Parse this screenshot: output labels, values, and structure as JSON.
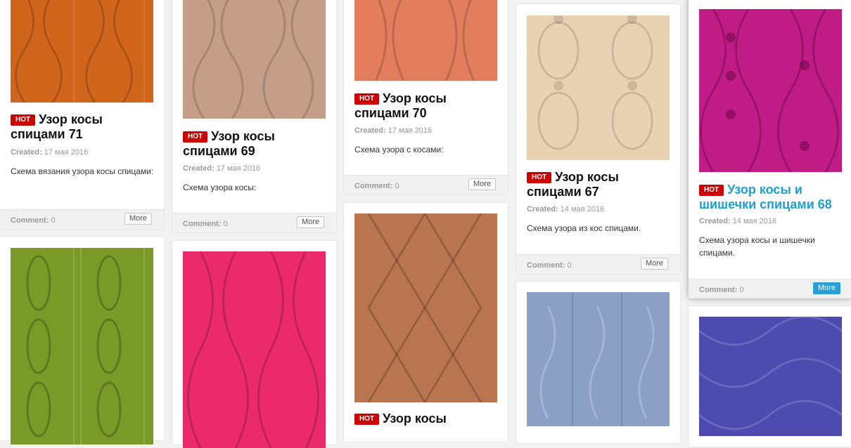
{
  "colors": {
    "hot_badge": "#cc0000",
    "link_hover": "#1a9fd0",
    "more_active": "#2a9fd6"
  },
  "labels": {
    "hot": "HOT",
    "created": "Created:",
    "comment": "Comment:",
    "more": "More"
  },
  "cards": [
    {
      "title": "Узор косы спицами 71",
      "date": "17 мая 2016",
      "description": "Схема вязания узора косы спицами:",
      "comments": "0",
      "image_color": "#d2651c",
      "hot": true
    },
    {
      "title": "Узор косы спицами 69",
      "date": "17 мая 2016",
      "description": "Схема узора косы:",
      "comments": "0",
      "image_color": "#c49e86",
      "hot": true
    },
    {
      "title": "Узор косы спицами 70",
      "date": "17 мая 2016",
      "description": "Схема узора с косами:",
      "comments": "0",
      "image_color": "#e27e5e",
      "hot": true
    },
    {
      "title": "Узор косы спицами 67",
      "date": "14 мая 2016",
      "description": "Схема узора из кос спицами.",
      "comments": "0",
      "image_color": "#e9d2b2",
      "hot": true
    },
    {
      "title": "Узор косы и шишечки спицами 68",
      "date": "14 мая 2016",
      "description": "Схема узора косы и шишечки спицами.",
      "comments": "0",
      "image_color": "#c11b85",
      "hot": true
    },
    {
      "image_color": "#7a9a28"
    },
    {
      "image_color": "#ea2a6a"
    },
    {
      "title": "Узор косы",
      "image_color": "#b9754f",
      "hot": true
    },
    {
      "image_color": "#8c9fc4"
    },
    {
      "image_color": "#4d4bb0"
    }
  ]
}
